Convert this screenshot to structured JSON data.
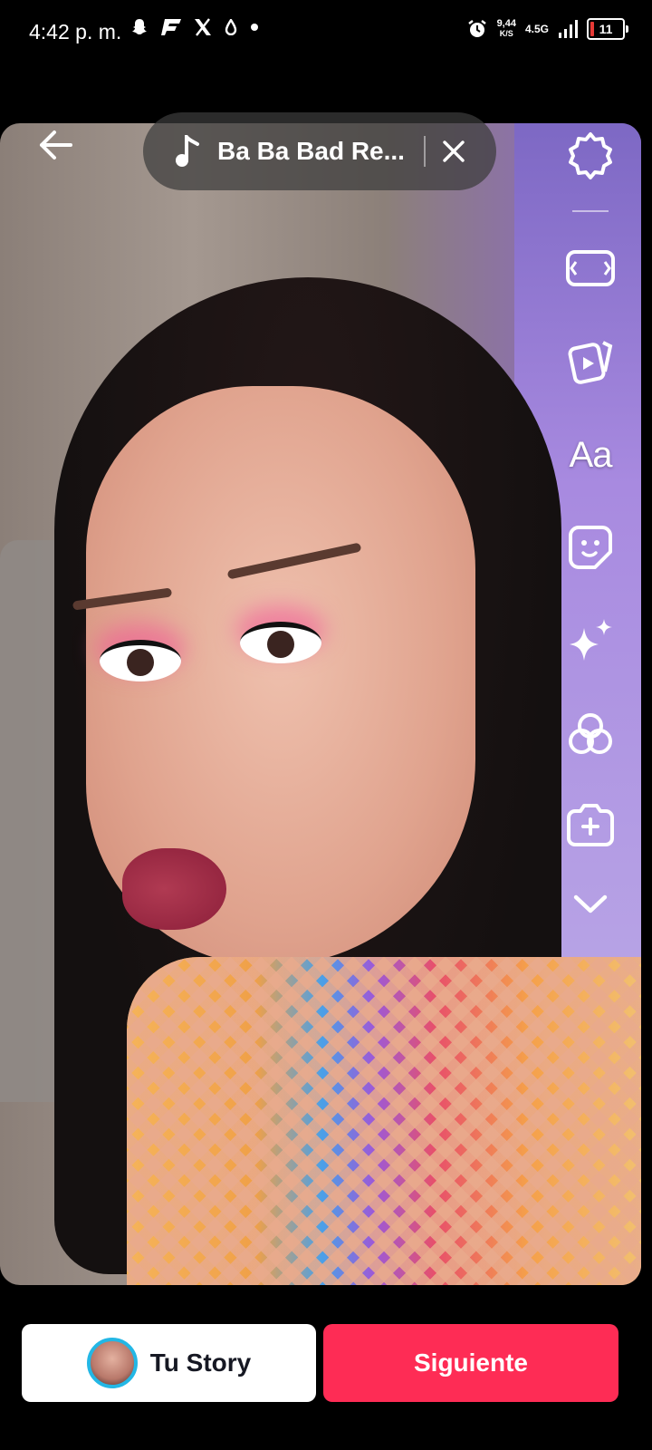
{
  "status_bar": {
    "time": "4:42 p. m.",
    "net_speed_value": "9,44",
    "net_speed_unit": "K/S",
    "network_type": "4.5G",
    "battery_level": "11",
    "left_icons": [
      "snapchat-icon",
      "flash-app-icon",
      "x-icon",
      "drop-icon",
      "dot-icon"
    ],
    "colors": {
      "battery_low": "#e53935"
    }
  },
  "editor": {
    "music_title": "Ba Ba Bad Re...",
    "tools": [
      "settings-icon",
      "resize-icon",
      "media-icon",
      "text-icon",
      "sticker-icon",
      "effects-icon",
      "filters-icon",
      "add-clip-icon",
      "expand-more-icon"
    ],
    "text_tool_label": "Aa"
  },
  "bottom": {
    "story_label": "Tu Story",
    "next_label": "Siguiente",
    "colors": {
      "next": "#fe2c55",
      "story_ring": "#23b7e5"
    }
  }
}
